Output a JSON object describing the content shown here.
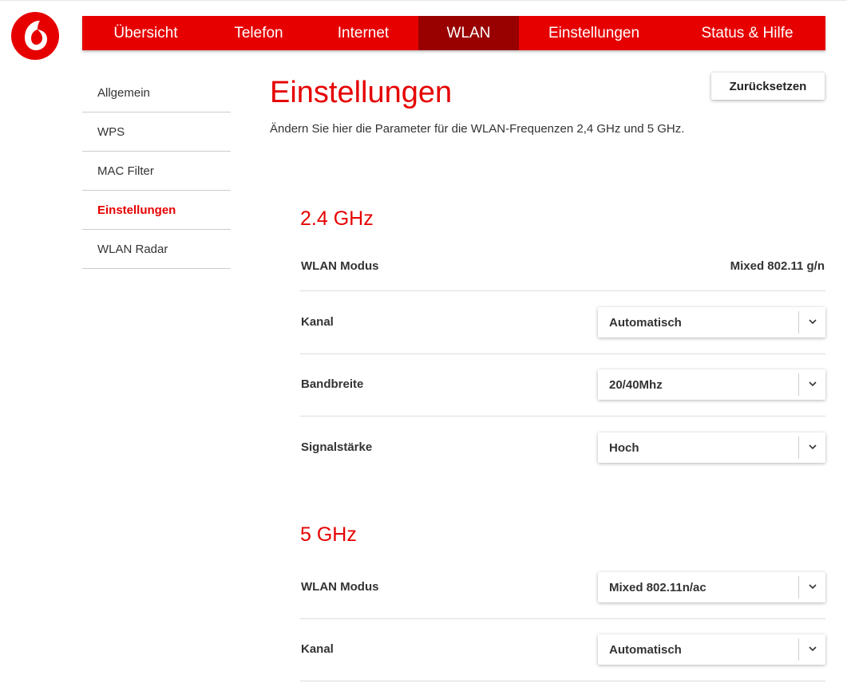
{
  "nav": {
    "items": [
      {
        "label": "Übersicht"
      },
      {
        "label": "Telefon"
      },
      {
        "label": "Internet"
      },
      {
        "label": "WLAN"
      },
      {
        "label": "Einstellungen"
      },
      {
        "label": "Status & Hilfe"
      }
    ],
    "active": "WLAN"
  },
  "sidebar": {
    "items": [
      {
        "label": "Allgemein"
      },
      {
        "label": "WPS"
      },
      {
        "label": "MAC Filter"
      },
      {
        "label": "Einstellungen"
      },
      {
        "label": "WLAN Radar"
      }
    ],
    "active": "Einstellungen"
  },
  "page": {
    "title": "Einstellungen",
    "reset_label": "Zurücksetzen",
    "intro": "Ändern Sie hier die Parameter für die WLAN-Frequenzen 2,4 GHz und 5 GHz."
  },
  "band24": {
    "title": "2.4 GHz",
    "mode_label": "WLAN Modus",
    "mode_value": "Mixed 802.11 g/n",
    "channel_label": "Kanal",
    "channel_value": "Automatisch",
    "bandwidth_label": "Bandbreite",
    "bandwidth_value": "20/40Mhz",
    "signal_label": "Signalstärke",
    "signal_value": "Hoch"
  },
  "band5": {
    "title": "5 GHz",
    "mode_label": "WLAN Modus",
    "mode_value": "Mixed 802.11n/ac",
    "channel_label": "Kanal",
    "channel_value": "Automatisch"
  },
  "colors": {
    "brand": "#e60000",
    "nav_active": "#990000"
  },
  "icons": {
    "logo": "vodafone-logo",
    "dropdown": "chevron-down-icon"
  }
}
